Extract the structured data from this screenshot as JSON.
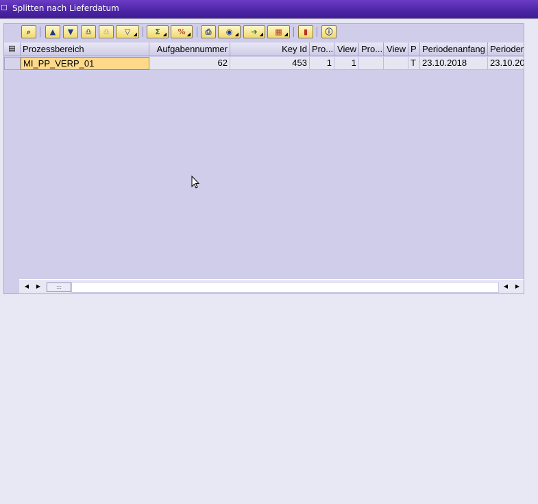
{
  "window": {
    "title": "Splitten nach Lieferdatum"
  },
  "toolbar": {
    "buttons": [
      {
        "name": "details-icon"
      },
      {
        "name": "sort-ascending-icon"
      },
      {
        "name": "sort-descending-icon"
      },
      {
        "name": "find-icon"
      },
      {
        "name": "find-next-icon"
      },
      {
        "name": "filter-icon"
      },
      {
        "name": "sum-icon"
      },
      {
        "name": "subtotal-icon"
      },
      {
        "name": "print-icon"
      },
      {
        "name": "views-icon"
      },
      {
        "name": "export-icon"
      },
      {
        "name": "layout-icon"
      },
      {
        "name": "graphic-icon"
      },
      {
        "name": "info-icon"
      }
    ]
  },
  "table": {
    "columns": [
      "Prozessbereich",
      "Aufgabennummer",
      "Key Id",
      "Pro...",
      "View",
      "Pro...",
      "View",
      "P",
      "Periodenanfang",
      "Perioden"
    ],
    "rows": [
      [
        "MI_PP_VERP_01",
        "62",
        "453",
        "1",
        "1",
        "",
        "",
        "T",
        "23.10.2018",
        "23.10.20"
      ]
    ]
  },
  "scrollbar": {
    "thumb": ":::"
  },
  "colors": {
    "title_bar": "#4d25a6",
    "grid_bg": "#cfcde9",
    "selected_cell": "#ffd98a"
  }
}
